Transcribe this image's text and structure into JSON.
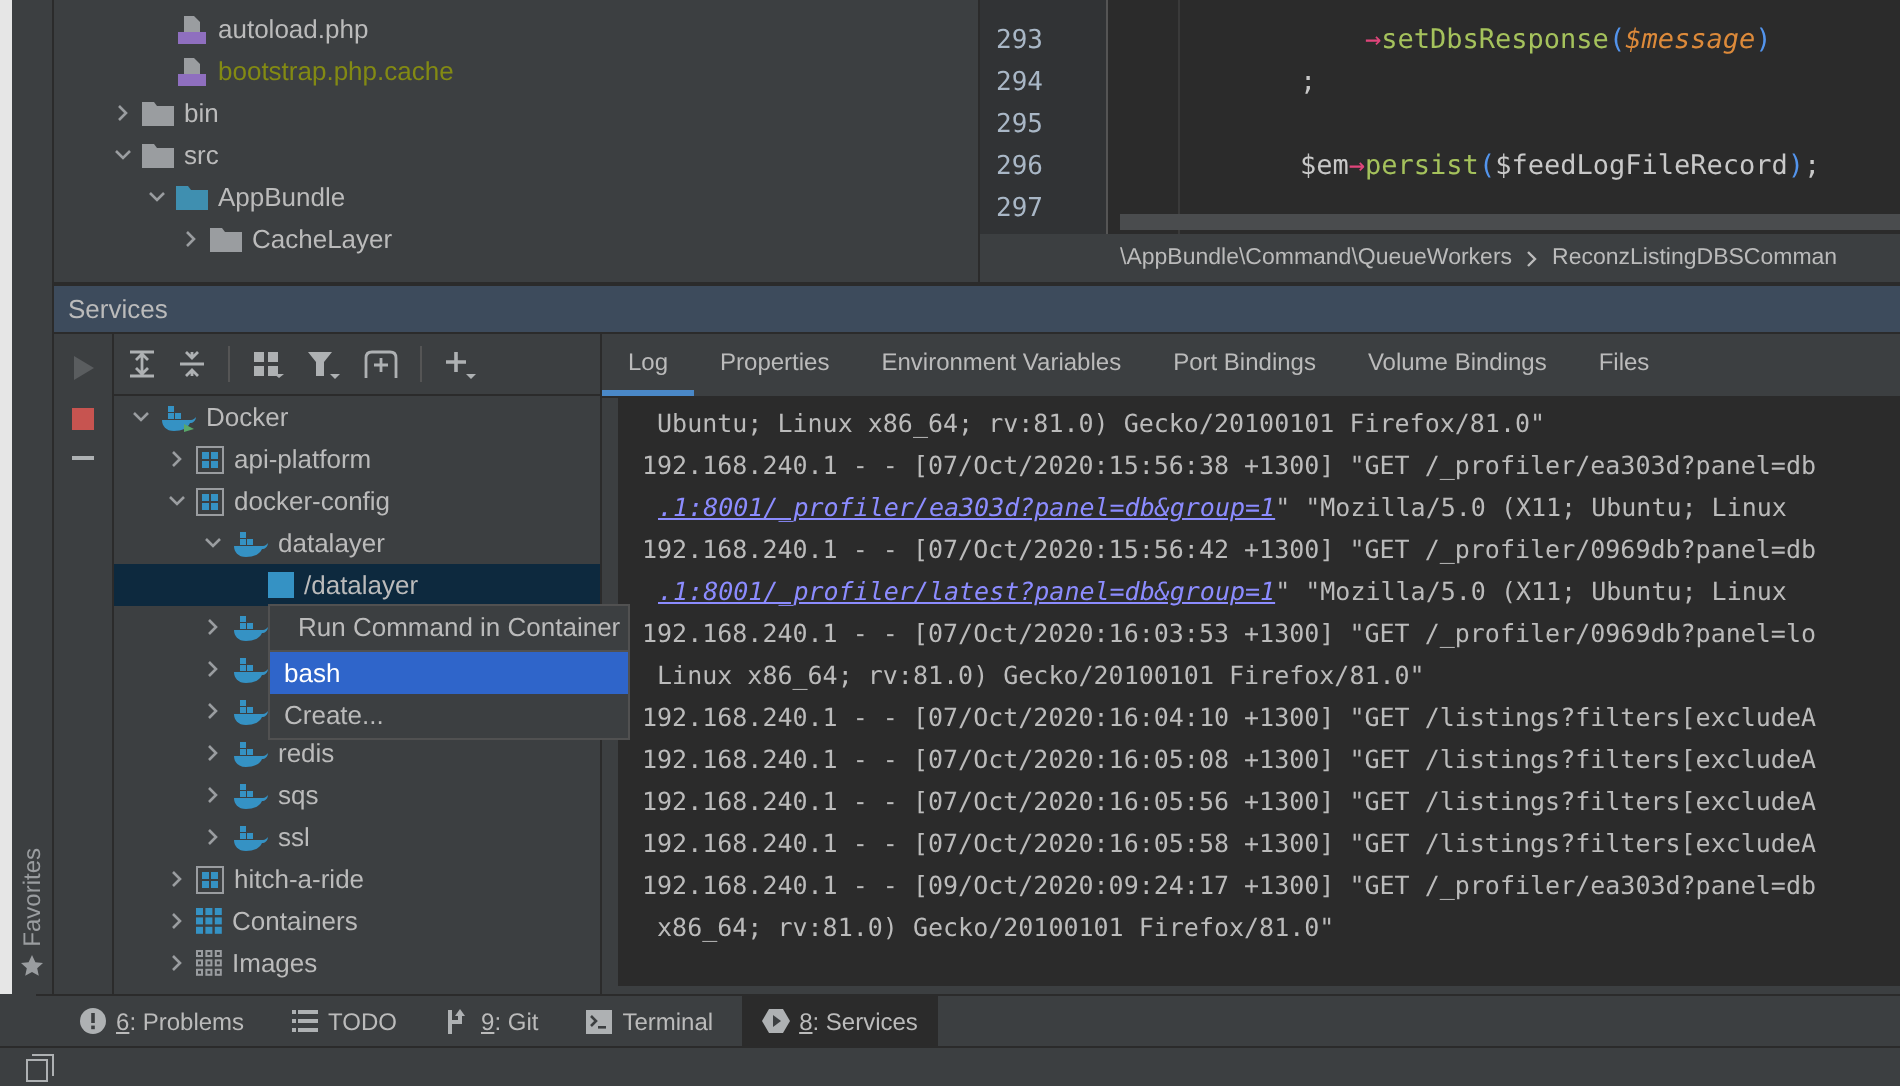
{
  "project_tree": {
    "scrolled_parent_children": [
      {
        "label": "autoload.php",
        "kind": "php",
        "ignored": false
      },
      {
        "label": "bootstrap.php.cache",
        "kind": "php",
        "ignored": true
      }
    ],
    "items": [
      {
        "label": "bin",
        "kind": "folder",
        "expanded": false
      },
      {
        "label": "src",
        "kind": "folder",
        "expanded": true,
        "children": [
          {
            "label": "AppBundle",
            "kind": "module",
            "expanded": true,
            "children": [
              {
                "label": "CacheLayer",
                "kind": "folder",
                "expanded": false
              }
            ]
          }
        ]
      }
    ]
  },
  "editor": {
    "lines": [
      {
        "number": "293",
        "tokens": [
          {
            "kind": "arrow",
            "text": "    →"
          },
          {
            "kind": "method",
            "text": "setDbsResponse"
          },
          {
            "kind": "paren",
            "text": "("
          },
          {
            "kind": "param",
            "text": "$message"
          },
          {
            "kind": "paren",
            "text": ")"
          }
        ]
      },
      {
        "number": "294",
        "tokens": [
          {
            "kind": "plain",
            "text": ";"
          }
        ]
      },
      {
        "number": "295"
      },
      {
        "number": "296",
        "tokens": [
          {
            "kind": "plain",
            "text": "$em"
          },
          {
            "kind": "arrow",
            "text": "→"
          },
          {
            "kind": "method",
            "text": "persist"
          },
          {
            "kind": "paren",
            "text": "("
          },
          {
            "kind": "plain",
            "text": "$feedLogFileRecord"
          },
          {
            "kind": "paren",
            "text": ")"
          },
          {
            "kind": "plain",
            "text": ";"
          }
        ]
      },
      {
        "number": "297"
      }
    ],
    "breadcrumb": [
      "\\AppBundle\\Command\\QueueWorkers",
      "ReconzListingDBSComman"
    ]
  },
  "side_tab": "Favorites",
  "services": {
    "title": "Services",
    "actions": [
      {
        "kind": "run",
        "disabled": true
      },
      {
        "kind": "stop",
        "disabled": false
      },
      {
        "kind": "remove",
        "disabled": false
      }
    ],
    "tree": [
      {
        "label": "Docker",
        "kind": "docker",
        "expanded": true,
        "selected": false,
        "children": [
          {
            "label": "api-platform",
            "kind": "compose",
            "expanded": false,
            "selected": false
          },
          {
            "label": "docker-config",
            "kind": "compose",
            "expanded": true,
            "selected": false,
            "children": [
              {
                "label": "datalayer",
                "kind": "service",
                "expanded": true,
                "selected": false,
                "children": [
                  {
                    "label": "/datalayer",
                    "kind": "container",
                    "selected": true
                  }
                ]
              },
              {
                "kind": "service",
                "expanded": false,
                "selected": false
              },
              {
                "kind": "service",
                "expanded": false,
                "selected": false
              },
              {
                "kind": "service",
                "expanded": false,
                "selected": false
              },
              {
                "label": "redis",
                "kind": "service",
                "expanded": false,
                "selected": false
              },
              {
                "label": "sqs",
                "kind": "service",
                "expanded": false,
                "selected": false
              },
              {
                "label": "ssl",
                "kind": "service",
                "expanded": false,
                "selected": false
              }
            ]
          },
          {
            "label": "hitch-a-ride",
            "kind": "compose",
            "expanded": false,
            "selected": false
          },
          {
            "label": "Containers",
            "kind": "containers",
            "expanded": false,
            "selected": false
          },
          {
            "label": "Images",
            "kind": "images",
            "expanded": false,
            "selected": false
          }
        ]
      }
    ],
    "menu": {
      "title": "Run Command in Container",
      "items": [
        {
          "label": "bash",
          "selected": true
        },
        {
          "label": "Create...",
          "selected": false
        }
      ]
    },
    "tabs": [
      {
        "label": "Log",
        "selected": true
      },
      {
        "label": "Properties",
        "selected": false
      },
      {
        "label": "Environment Variables",
        "selected": false
      },
      {
        "label": "Port Bindings",
        "selected": false
      },
      {
        "label": "Volume Bindings",
        "selected": false
      },
      {
        "label": "Files",
        "selected": false
      }
    ],
    "log": [
      [
        {
          "kind": "text",
          "text": " Ubuntu; Linux x86_64; rv:81.0) Gecko/20100101 Firefox/81.0\""
        }
      ],
      [
        {
          "kind": "text",
          "text": "192.168.240.1 - - [07/Oct/2020:15:56:38 +1300] \"GET /_profiler/ea303d?panel=db"
        }
      ],
      [
        {
          "kind": "link",
          "text": ".1:8001/_profiler/ea303d?panel=db&group=1"
        },
        {
          "kind": "text",
          "text": "\" \"Mozilla/5.0 (X11; Ubuntu; Linux"
        }
      ],
      [
        {
          "kind": "text",
          "text": "192.168.240.1 - - [07/Oct/2020:15:56:42 +1300] \"GET /_profiler/0969db?panel=db"
        }
      ],
      [
        {
          "kind": "link",
          "text": ".1:8001/_profiler/latest?panel=db&group=1"
        },
        {
          "kind": "text",
          "text": "\" \"Mozilla/5.0 (X11; Ubuntu; Linux"
        }
      ],
      [
        {
          "kind": "text",
          "text": "192.168.240.1 - - [07/Oct/2020:16:03:53 +1300] \"GET /_profiler/0969db?panel=lo"
        }
      ],
      [
        {
          "kind": "text",
          "text": " Linux x86_64; rv:81.0) Gecko/20100101 Firefox/81.0\""
        }
      ],
      [
        {
          "kind": "text",
          "text": "192.168.240.1 - - [07/Oct/2020:16:04:10 +1300] \"GET /listings?filters[excludeA"
        }
      ],
      [
        {
          "kind": "text",
          "text": "192.168.240.1 - - [07/Oct/2020:16:05:08 +1300] \"GET /listings?filters[excludeA"
        }
      ],
      [
        {
          "kind": "text",
          "text": "192.168.240.1 - - [07/Oct/2020:16:05:56 +1300] \"GET /listings?filters[excludeA"
        }
      ],
      [
        {
          "kind": "text",
          "text": "192.168.240.1 - - [07/Oct/2020:16:05:58 +1300] \"GET /listings?filters[excludeA"
        }
      ],
      [
        {
          "kind": "text",
          "text": "192.168.240.1 - - [09/Oct/2020:09:24:17 +1300] \"GET /_profiler/ea303d?panel=db"
        }
      ],
      [
        {
          "kind": "text",
          "text": " x86_64; rv:81.0) Gecko/20100101 Firefox/81.0\""
        }
      ]
    ]
  },
  "tool_tabs": [
    {
      "kind": "problems",
      "mnemonic": "6",
      "label": ": Problems",
      "selected": false
    },
    {
      "kind": "todo",
      "label": "TODO",
      "selected": false
    },
    {
      "kind": "git",
      "mnemonic": "9",
      "label": ": Git",
      "selected": false
    },
    {
      "kind": "terminal",
      "label": "Terminal",
      "selected": false
    },
    {
      "kind": "services",
      "mnemonic": "8",
      "label": ": Services",
      "selected": true
    }
  ]
}
